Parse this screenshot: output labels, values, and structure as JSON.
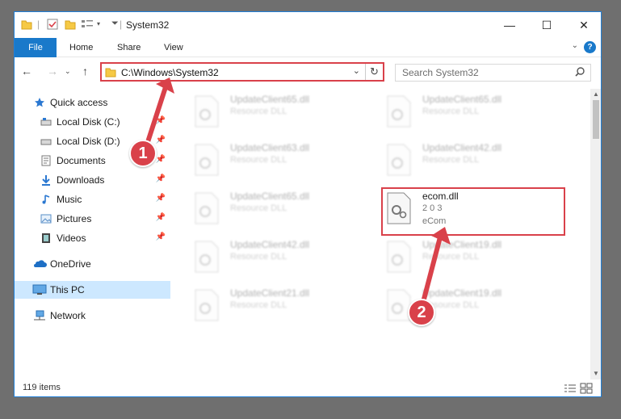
{
  "window": {
    "title": "System32",
    "controls": {
      "minimize": "—",
      "maximize": "☐",
      "close": "✕"
    }
  },
  "ribbon": {
    "file": "File",
    "tabs": [
      "Home",
      "Share",
      "View"
    ],
    "help": "?"
  },
  "address": {
    "path": "C:\\Windows\\System32",
    "refresh": "↻"
  },
  "search": {
    "placeholder": "Search System32"
  },
  "nav": {
    "quick_access": "Quick access",
    "items": [
      {
        "label": "Local Disk (C:)",
        "pinned": true
      },
      {
        "label": "Local Disk (D:)",
        "pinned": true
      },
      {
        "label": "Documents",
        "pinned": true
      },
      {
        "label": "Downloads",
        "pinned": true
      },
      {
        "label": "Music",
        "pinned": true
      },
      {
        "label": "Pictures",
        "pinned": true
      },
      {
        "label": "Videos",
        "pinned": true
      }
    ],
    "onedrive": "OneDrive",
    "this_pc": "This PC",
    "network": "Network"
  },
  "files": [
    {
      "name": "UpdateClient65.dll",
      "desc": "Resource DLL",
      "sub": ""
    },
    {
      "name": "UpdateClient65.dll",
      "desc": "Resource DLL",
      "sub": ""
    },
    {
      "name": "UpdateClient63.dll",
      "desc": "Resource DLL",
      "sub": ""
    },
    {
      "name": "UpdateClient42.dll",
      "desc": "Resource DLL",
      "sub": ""
    },
    {
      "name": "UpdateClient65.dll",
      "desc": "Resource DLL",
      "sub": ""
    },
    {
      "name": "ecom.dll",
      "desc": "2 0 3",
      "sub": "eCom"
    },
    {
      "name": "UpdateClient42.dll",
      "desc": "Resource DLL",
      "sub": ""
    },
    {
      "name": "UpdateClient19.dll",
      "desc": "Resource DLL",
      "sub": ""
    },
    {
      "name": "UpdateClient21.dll",
      "desc": "Resource DLL",
      "sub": ""
    },
    {
      "name": "UpdateClient19.dll",
      "desc": "Resource DLL",
      "sub": ""
    }
  ],
  "status": {
    "items": "119 items"
  },
  "annotations": {
    "step1": "1",
    "step2": "2"
  },
  "colors": {
    "accent": "#1979ca",
    "highlight": "#d9414a",
    "selected": "#cde8ff"
  }
}
